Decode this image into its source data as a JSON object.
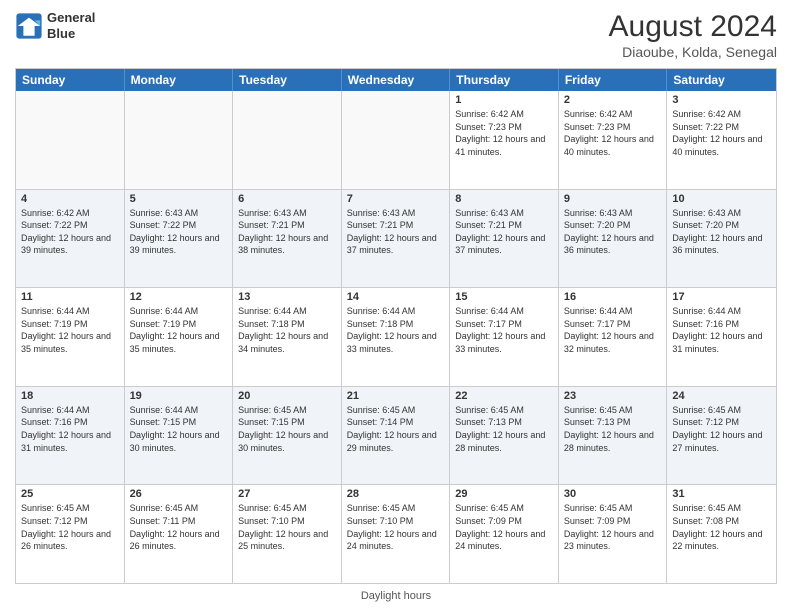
{
  "header": {
    "logo_line1": "General",
    "logo_line2": "Blue",
    "main_title": "August 2024",
    "subtitle": "Diaoube, Kolda, Senegal"
  },
  "day_headers": [
    "Sunday",
    "Monday",
    "Tuesday",
    "Wednesday",
    "Thursday",
    "Friday",
    "Saturday"
  ],
  "footer_text": "Daylight hours",
  "rows": [
    [
      {
        "date": "",
        "info": "",
        "empty": true
      },
      {
        "date": "",
        "info": "",
        "empty": true
      },
      {
        "date": "",
        "info": "",
        "empty": true
      },
      {
        "date": "",
        "info": "",
        "empty": true
      },
      {
        "date": "1",
        "info": "Sunrise: 6:42 AM\nSunset: 7:23 PM\nDaylight: 12 hours\nand 41 minutes."
      },
      {
        "date": "2",
        "info": "Sunrise: 6:42 AM\nSunset: 7:23 PM\nDaylight: 12 hours\nand 40 minutes."
      },
      {
        "date": "3",
        "info": "Sunrise: 6:42 AM\nSunset: 7:22 PM\nDaylight: 12 hours\nand 40 minutes."
      }
    ],
    [
      {
        "date": "4",
        "info": "Sunrise: 6:42 AM\nSunset: 7:22 PM\nDaylight: 12 hours\nand 39 minutes."
      },
      {
        "date": "5",
        "info": "Sunrise: 6:43 AM\nSunset: 7:22 PM\nDaylight: 12 hours\nand 39 minutes."
      },
      {
        "date": "6",
        "info": "Sunrise: 6:43 AM\nSunset: 7:21 PM\nDaylight: 12 hours\nand 38 minutes."
      },
      {
        "date": "7",
        "info": "Sunrise: 6:43 AM\nSunset: 7:21 PM\nDaylight: 12 hours\nand 37 minutes."
      },
      {
        "date": "8",
        "info": "Sunrise: 6:43 AM\nSunset: 7:21 PM\nDaylight: 12 hours\nand 37 minutes."
      },
      {
        "date": "9",
        "info": "Sunrise: 6:43 AM\nSunset: 7:20 PM\nDaylight: 12 hours\nand 36 minutes."
      },
      {
        "date": "10",
        "info": "Sunrise: 6:43 AM\nSunset: 7:20 PM\nDaylight: 12 hours\nand 36 minutes."
      }
    ],
    [
      {
        "date": "11",
        "info": "Sunrise: 6:44 AM\nSunset: 7:19 PM\nDaylight: 12 hours\nand 35 minutes."
      },
      {
        "date": "12",
        "info": "Sunrise: 6:44 AM\nSunset: 7:19 PM\nDaylight: 12 hours\nand 35 minutes."
      },
      {
        "date": "13",
        "info": "Sunrise: 6:44 AM\nSunset: 7:18 PM\nDaylight: 12 hours\nand 34 minutes."
      },
      {
        "date": "14",
        "info": "Sunrise: 6:44 AM\nSunset: 7:18 PM\nDaylight: 12 hours\nand 33 minutes."
      },
      {
        "date": "15",
        "info": "Sunrise: 6:44 AM\nSunset: 7:17 PM\nDaylight: 12 hours\nand 33 minutes."
      },
      {
        "date": "16",
        "info": "Sunrise: 6:44 AM\nSunset: 7:17 PM\nDaylight: 12 hours\nand 32 minutes."
      },
      {
        "date": "17",
        "info": "Sunrise: 6:44 AM\nSunset: 7:16 PM\nDaylight: 12 hours\nand 31 minutes."
      }
    ],
    [
      {
        "date": "18",
        "info": "Sunrise: 6:44 AM\nSunset: 7:16 PM\nDaylight: 12 hours\nand 31 minutes."
      },
      {
        "date": "19",
        "info": "Sunrise: 6:44 AM\nSunset: 7:15 PM\nDaylight: 12 hours\nand 30 minutes."
      },
      {
        "date": "20",
        "info": "Sunrise: 6:45 AM\nSunset: 7:15 PM\nDaylight: 12 hours\nand 30 minutes."
      },
      {
        "date": "21",
        "info": "Sunrise: 6:45 AM\nSunset: 7:14 PM\nDaylight: 12 hours\nand 29 minutes."
      },
      {
        "date": "22",
        "info": "Sunrise: 6:45 AM\nSunset: 7:13 PM\nDaylight: 12 hours\nand 28 minutes."
      },
      {
        "date": "23",
        "info": "Sunrise: 6:45 AM\nSunset: 7:13 PM\nDaylight: 12 hours\nand 28 minutes."
      },
      {
        "date": "24",
        "info": "Sunrise: 6:45 AM\nSunset: 7:12 PM\nDaylight: 12 hours\nand 27 minutes."
      }
    ],
    [
      {
        "date": "25",
        "info": "Sunrise: 6:45 AM\nSunset: 7:12 PM\nDaylight: 12 hours\nand 26 minutes."
      },
      {
        "date": "26",
        "info": "Sunrise: 6:45 AM\nSunset: 7:11 PM\nDaylight: 12 hours\nand 26 minutes."
      },
      {
        "date": "27",
        "info": "Sunrise: 6:45 AM\nSunset: 7:10 PM\nDaylight: 12 hours\nand 25 minutes."
      },
      {
        "date": "28",
        "info": "Sunrise: 6:45 AM\nSunset: 7:10 PM\nDaylight: 12 hours\nand 24 minutes."
      },
      {
        "date": "29",
        "info": "Sunrise: 6:45 AM\nSunset: 7:09 PM\nDaylight: 12 hours\nand 24 minutes."
      },
      {
        "date": "30",
        "info": "Sunrise: 6:45 AM\nSunset: 7:09 PM\nDaylight: 12 hours\nand 23 minutes."
      },
      {
        "date": "31",
        "info": "Sunrise: 6:45 AM\nSunset: 7:08 PM\nDaylight: 12 hours\nand 22 minutes."
      }
    ]
  ]
}
